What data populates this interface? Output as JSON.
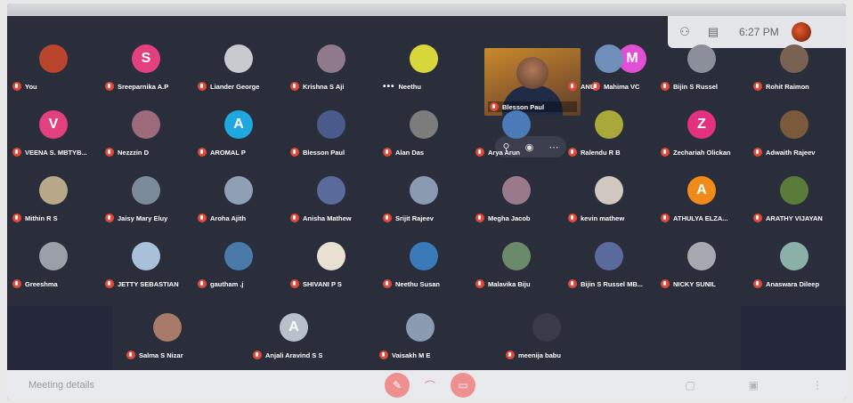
{
  "status": {
    "time": "6:27 PM",
    "people_icon": "people-icon",
    "chat_icon": "chat-icon"
  },
  "meeting": {
    "details_label": "Meeting details"
  },
  "video_tile": {
    "name": "Blesson Paul"
  },
  "participants": [
    {
      "name": "You",
      "color": "#b8452c"
    },
    {
      "name": "Sreeparnika A.P",
      "initial": "S",
      "color": "#e3407f"
    },
    {
      "name": "Liander George",
      "color": "#c9c9d0"
    },
    {
      "name": "Krishna S Aji",
      "color": "#8f7a8c"
    },
    {
      "name": "Neethu",
      "color": "#d7d63a",
      "more": true
    },
    {
      "name": "Mahima VC",
      "initial": "M",
      "color": "#e04fd4"
    },
    {
      "name": "ANU",
      "color": "#6f8fb8"
    },
    {
      "name": "Bijin S Russel",
      "color": "#8a8f99"
    },
    {
      "name": "Rohit Raimon",
      "color": "#7a6252"
    },
    {
      "name": "VEENA S. MBTYB...",
      "initial": "V",
      "color": "#e3407f"
    },
    {
      "name": "Nezzzin D",
      "color": "#9c6a7a"
    },
    {
      "name": "AROMAL P",
      "initial": "A",
      "color": "#1fa7e0"
    },
    {
      "name": "Blesson Paul",
      "color": "#4a5a8a"
    },
    {
      "name": "Alan Das",
      "color": "#7c7c7c"
    },
    {
      "name": "Arya Arun",
      "color": "#4a7ab8"
    },
    {
      "name": "Ralendu R B",
      "color": "#a9a93a"
    },
    {
      "name": "Zechariah Olickan",
      "initial": "Z",
      "color": "#e3307f"
    },
    {
      "name": "Adwaith Rajeev",
      "color": "#7a5a3a"
    },
    {
      "name": "Mithin R S",
      "color": "#b7a88a"
    },
    {
      "name": "Jaisy Mary Eluy",
      "color": "#7a8a99"
    },
    {
      "name": "Aroha Ajith",
      "color": "#8fa0b5"
    },
    {
      "name": "Anisha Mathew",
      "color": "#5a6a9a"
    },
    {
      "name": "Srijit Rajeev",
      "color": "#8a9ab0"
    },
    {
      "name": "Megha Jacob",
      "color": "#9a7a8a"
    },
    {
      "name": "kevin mathew",
      "color": "#d0c8c0"
    },
    {
      "name": "ATHULYA ELZA...",
      "initial": "A",
      "color": "#f08a1a"
    },
    {
      "name": "ARATHY VIJAYAN",
      "color": "#5a7a3a"
    },
    {
      "name": "Greeshma",
      "color": "#9aa0a8"
    },
    {
      "name": "JETTY SEBASTIAN",
      "color": "#a8c0d8"
    },
    {
      "name": "gautham .j",
      "color": "#4a7aa8"
    },
    {
      "name": "SHIVANI P S",
      "color": "#e8e0d0"
    },
    {
      "name": "Neethu Susan",
      "color": "#3a7ab8"
    },
    {
      "name": "Malavika Biju",
      "color": "#6a8a6a"
    },
    {
      "name": "Bijin S Russel MB...",
      "color": "#5a6a9a"
    },
    {
      "name": "NICKY SUNIL",
      "color": "#a8a8b0"
    },
    {
      "name": "Anaswara Dileep",
      "color": "#8ab0a8"
    },
    {
      "name": "Salma S Nizar",
      "color": "#a87a6a"
    },
    {
      "name": "Anjali Aravind S S",
      "initial": "A",
      "color": "#b8c0cc"
    },
    {
      "name": "Vaisakh M E",
      "color": "#8a9ab0"
    },
    {
      "name": "meenija babu",
      "color": "#3a3a4a"
    }
  ]
}
